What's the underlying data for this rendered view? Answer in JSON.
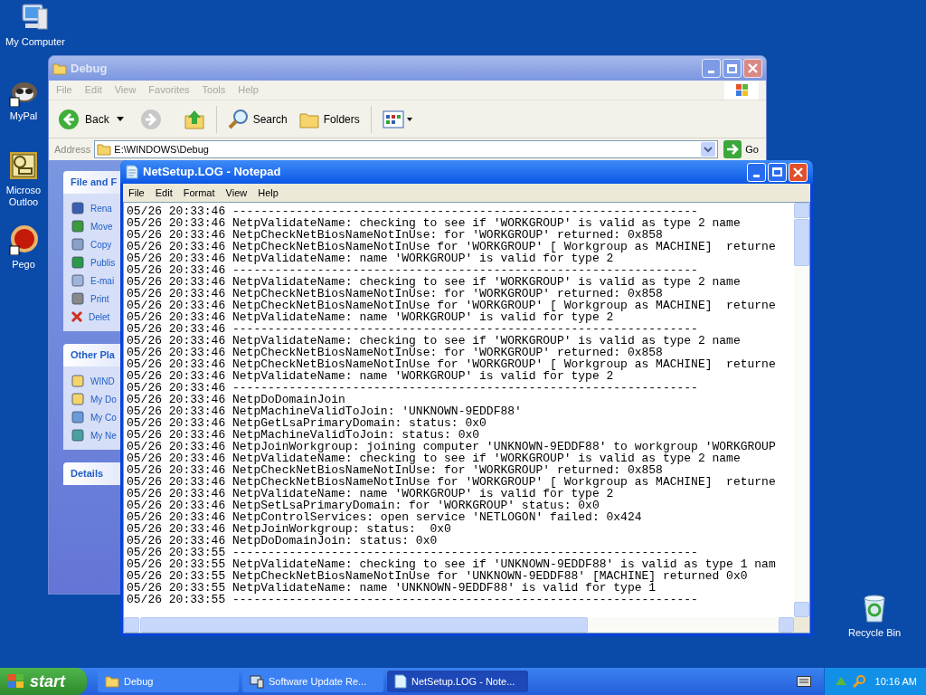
{
  "desktop_icons": [
    {
      "label": "My Computer",
      "kind": "computer"
    },
    {
      "label": "MyPal",
      "kind": "raccoon"
    },
    {
      "label": "Microso\nOutloo",
      "kind": "outlook"
    },
    {
      "label": "Pego",
      "kind": "ball"
    },
    {
      "label": "Recycle Bin",
      "kind": "recycle"
    }
  ],
  "explorer": {
    "title": "Debug",
    "menu": [
      "File",
      "Edit",
      "View",
      "Favorites",
      "Tools",
      "Help"
    ],
    "toolbar": {
      "back": "Back",
      "search": "Search",
      "folders": "Folders"
    },
    "address": {
      "label": "Address",
      "value": "E:\\WINDOWS\\Debug",
      "go": "Go"
    },
    "panels": [
      {
        "title": "File and F",
        "items": [
          "Rena",
          "Move",
          "Copy",
          "Publis",
          "E-mai",
          "Print",
          "Delet"
        ]
      },
      {
        "title": "Other Pla",
        "items": [
          "WIND",
          "My Do",
          "My Co",
          "My Ne"
        ]
      },
      {
        "title": "Details"
      }
    ]
  },
  "notepad": {
    "title": "NetSetup.LOG - Notepad",
    "menu": [
      "File",
      "Edit",
      "Format",
      "View",
      "Help"
    ],
    "lines": [
      "05/26 20:33:46 ------------------------------------------------------------------",
      "05/26 20:33:46 NetpValidateName: checking to see if 'WORKGROUP' is valid as type 2 name",
      "05/26 20:33:46 NetpCheckNetBiosNameNotInUse: for 'WORKGROUP' returned: 0x858",
      "05/26 20:33:46 NetpCheckNetBiosNameNotInUse for 'WORKGROUP' [ Workgroup as MACHINE]  returne",
      "05/26 20:33:46 NetpValidateName: name 'WORKGROUP' is valid for type 2",
      "05/26 20:33:46 ------------------------------------------------------------------",
      "05/26 20:33:46 NetpValidateName: checking to see if 'WORKGROUP' is valid as type 2 name",
      "05/26 20:33:46 NetpCheckNetBiosNameNotInUse: for 'WORKGROUP' returned: 0x858",
      "05/26 20:33:46 NetpCheckNetBiosNameNotInUse for 'WORKGROUP' [ Workgroup as MACHINE]  returne",
      "05/26 20:33:46 NetpValidateName: name 'WORKGROUP' is valid for type 2",
      "05/26 20:33:46 ------------------------------------------------------------------",
      "05/26 20:33:46 NetpValidateName: checking to see if 'WORKGROUP' is valid as type 2 name",
      "05/26 20:33:46 NetpCheckNetBiosNameNotInUse: for 'WORKGROUP' returned: 0x858",
      "05/26 20:33:46 NetpCheckNetBiosNameNotInUse for 'WORKGROUP' [ Workgroup as MACHINE]  returne",
      "05/26 20:33:46 NetpValidateName: name 'WORKGROUP' is valid for type 2",
      "05/26 20:33:46 ------------------------------------------------------------------",
      "05/26 20:33:46 NetpDoDomainJoin",
      "05/26 20:33:46 NetpMachineValidToJoin: 'UNKNOWN-9EDDF88'",
      "05/26 20:33:46 NetpGetLsaPrimaryDomain: status: 0x0",
      "05/26 20:33:46 NetpMachineValidToJoin: status: 0x0",
      "05/26 20:33:46 NetpJoinWorkgroup: joining computer 'UNKNOWN-9EDDF88' to workgroup 'WORKGROUP",
      "05/26 20:33:46 NetpValidateName: checking to see if 'WORKGROUP' is valid as type 2 name",
      "05/26 20:33:46 NetpCheckNetBiosNameNotInUse: for 'WORKGROUP' returned: 0x858",
      "05/26 20:33:46 NetpCheckNetBiosNameNotInUse for 'WORKGROUP' [ Workgroup as MACHINE]  returne",
      "05/26 20:33:46 NetpValidateName: name 'WORKGROUP' is valid for type 2",
      "05/26 20:33:46 NetpSetLsaPrimaryDomain: for 'WORKGROUP' status: 0x0",
      "05/26 20:33:46 NetpControlServices: open service 'NETLOGON' failed: 0x424",
      "05/26 20:33:46 NetpJoinWorkgroup: status:  0x0",
      "05/26 20:33:46 NetpDoDomainJoin: status: 0x0",
      "05/26 20:33:55 ------------------------------------------------------------------",
      "05/26 20:33:55 NetpValidateName: checking to see if 'UNKNOWN-9EDDF88' is valid as type 1 nam",
      "05/26 20:33:55 NetpCheckNetBiosNameNotInUse for 'UNKNOWN-9EDDF88' [MACHINE] returned 0x0",
      "05/26 20:33:55 NetpValidateName: name 'UNKNOWN-9EDDF88' is valid for type 1",
      "05/26 20:33:55 ------------------------------------------------------------------"
    ]
  },
  "taskbar": {
    "start": "start",
    "buttons": [
      {
        "label": "Debug",
        "selected": false,
        "kind": "folder"
      },
      {
        "label": "Software Update Re...",
        "selected": false,
        "kind": "update"
      },
      {
        "label": "NetSetup.LOG - Note...",
        "selected": true,
        "kind": "notepad"
      }
    ],
    "clock": "10:16 AM"
  }
}
